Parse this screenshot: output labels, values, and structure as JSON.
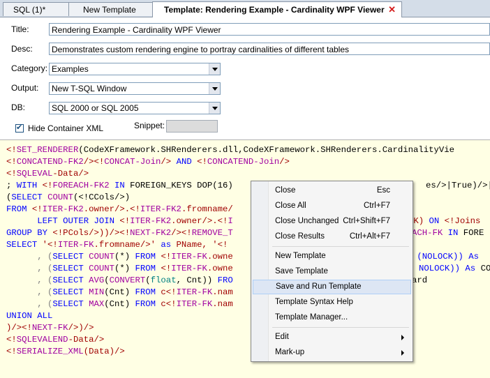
{
  "tabs": [
    {
      "label": "SQL (1)*"
    },
    {
      "label": "New Template"
    },
    {
      "label": "Template: Rendering Example - Cardinality WPF Viewer"
    }
  ],
  "form": {
    "title_label": "Title:",
    "title_value": "Rendering Example - Cardinality WPF Viewer",
    "desc_label": "Desc:",
    "desc_value": "Demonstrates custom rendering engine to portray cardinalities of different tables",
    "category_label": "Category:",
    "category_value": "Examples",
    "output_label": "Output:",
    "output_value": "New T-SQL Window",
    "db_label": "DB:",
    "db_value": "SQL 2000 or SQL 2005",
    "hide_xml_label": "Hide Container XML",
    "snippet_label": "Snippet:"
  },
  "code": {
    "l1": [
      "<!",
      "SET_RENDERER",
      "(CodeXFramework.SHRenderers.dll,CodeXFramework.SHRenderers.CardinalityVie"
    ],
    "l2": [
      "<!",
      "CONCATEND-FK2",
      "/><!",
      "CONCAT-Join",
      "/> ",
      "AND",
      " <!",
      "CONCATEND-Join",
      "/>"
    ],
    "l3": [
      "<!",
      "SQLEVAL",
      "-Data/>"
    ],
    "l4": [
      "; ",
      "WITH",
      " <!",
      "FOREACH-FK2",
      " ",
      "IN",
      " FOREIGN_KEYS DOP(16)",
      "es/>|True)/>|<"
    ],
    "l5": [
      "(",
      "SELECT",
      " ",
      "COUNT",
      "(<!CCols/>)"
    ],
    "l6": [
      "FROM",
      " <!",
      "ITER-FK2",
      ".owner/>.<!",
      "ITER-FK2",
      ".fromname/"
    ],
    "l7": [
      "      ",
      "LEFT OUTER JOIN",
      " <!",
      "ITER-FK2",
      ".owner/>.<!",
      "I",
      "CK) ",
      "ON",
      " <!Joins"
    ],
    "l8": [
      "GROUP BY",
      " <!PCols/>))/><!",
      "NEXT-FK2",
      "/><!",
      "REMOVE_T",
      "ACH-FK ",
      "IN",
      " FORE"
    ],
    "l9": [
      "SELECT",
      " '<!",
      "ITER-FK",
      ".fromname/>' ",
      "as",
      " PName, '<!"
    ],
    "l10": [
      "      , (",
      "SELECT",
      " ",
      "COUNT",
      "(*) ",
      "FROM",
      " <!",
      "ITER-FK",
      ".owne",
      " (NOLOCK)) ",
      "As"
    ],
    "l11": [
      "      , (",
      "SELECT",
      " ",
      "COUNT",
      "(*) ",
      "FROM",
      " <!",
      "ITER-FK",
      ".owne",
      "NOLOCK)) ",
      "As",
      " CO"
    ],
    "l12": [
      "      , (",
      "SELECT",
      " ",
      "AVG",
      "(",
      "CONVERT",
      "(",
      "float",
      ", Cnt)) ",
      "FRO",
      "ard"
    ],
    "l13": [
      "      , (",
      "SELECT",
      " ",
      "MIN",
      "(Cnt) ",
      "FROM",
      " c<!",
      "ITER-FK",
      ".nam"
    ],
    "l14": [
      "      , (",
      "SELECT",
      " ",
      "MAX",
      "(Cnt) ",
      "FROM",
      " c<!",
      "ITER-FK",
      ".nam"
    ],
    "l15": [
      "UNION ALL"
    ],
    "l16": [
      ")/><!",
      "NEXT-FK",
      "/>)/>"
    ],
    "l17": [
      "<!",
      "SQLEVALEND",
      "-Data/>"
    ],
    "l18": [
      "<!",
      "SERIALIZE_XML",
      "(Data)/>"
    ]
  },
  "menu": {
    "items": [
      {
        "label": "Close",
        "shortcut": "Esc"
      },
      {
        "label": "Close All",
        "shortcut": "Ctrl+F7"
      },
      {
        "label": "Close Unchanged",
        "shortcut": "Ctrl+Shift+F7"
      },
      {
        "label": "Close Results",
        "shortcut": "Ctrl+Alt+F7"
      },
      {
        "label": "New Template",
        "shortcut": ""
      },
      {
        "label": "Save Template",
        "shortcut": ""
      },
      {
        "label": "Save and Run Template",
        "shortcut": ""
      },
      {
        "label": "Template Syntax Help",
        "shortcut": ""
      },
      {
        "label": "Template Manager...",
        "shortcut": ""
      },
      {
        "label": "Edit",
        "shortcut": ""
      },
      {
        "label": "Mark-up",
        "shortcut": ""
      }
    ]
  }
}
